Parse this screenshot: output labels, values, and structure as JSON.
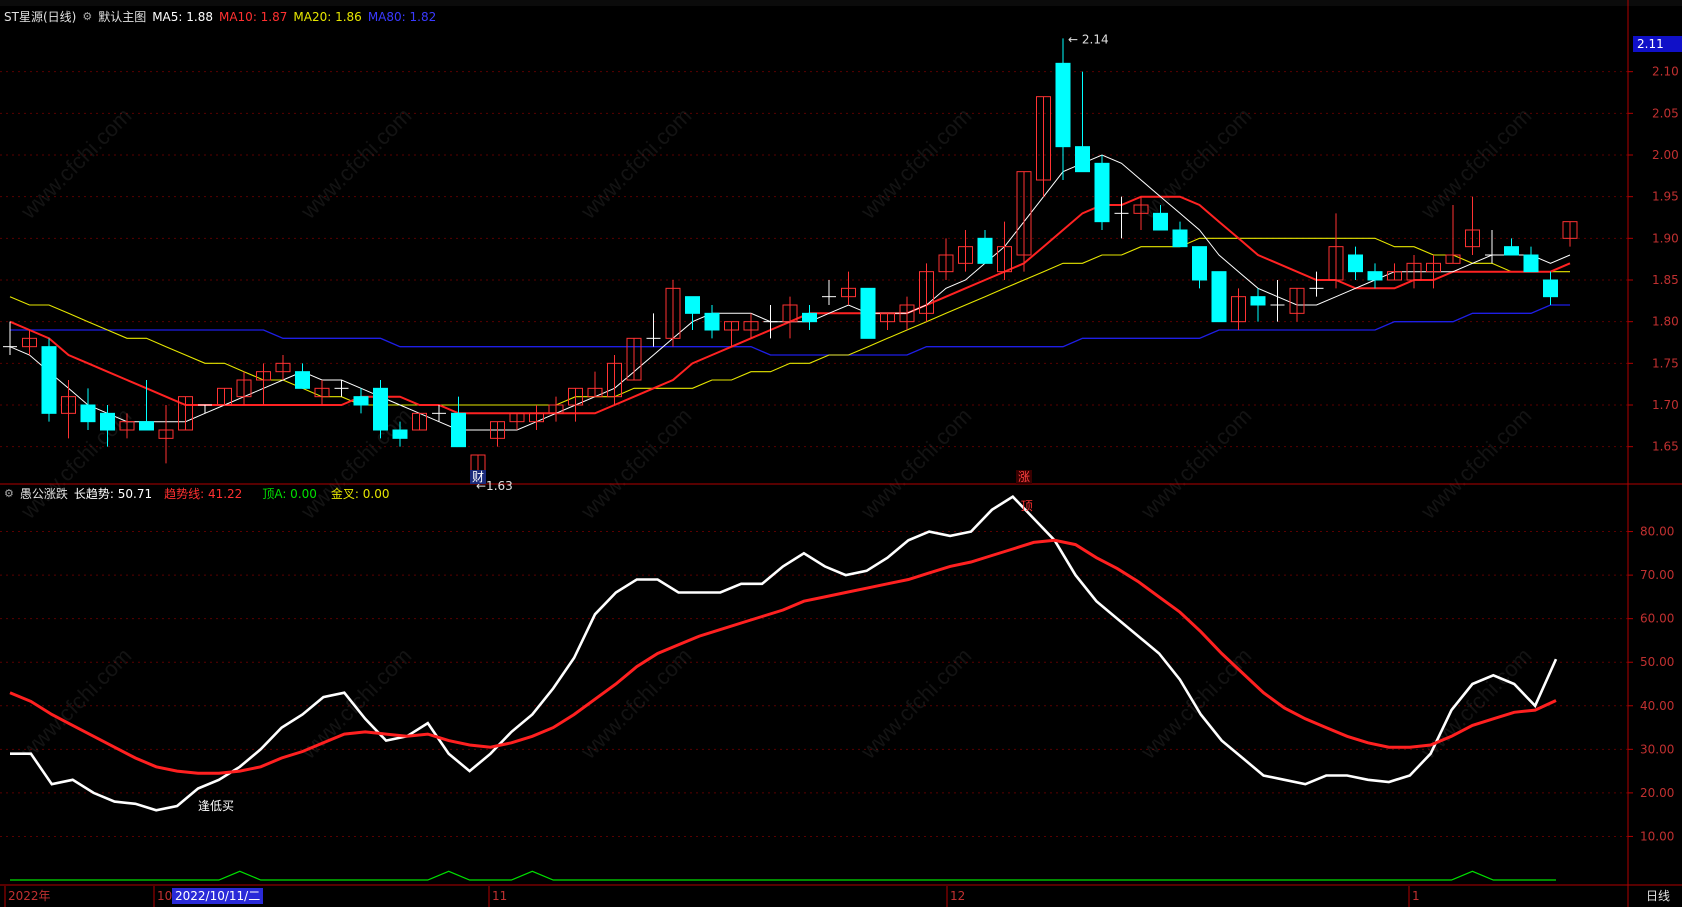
{
  "main_header": {
    "stock_name": "ST星源(日线)",
    "template_name": "默认主图",
    "ma5_label": "MA5: 1.88",
    "ma10_label": "MA10: 1.87",
    "ma20_label": "MA20: 1.86",
    "ma80_label": "MA80: 1.82"
  },
  "sub_header": {
    "indicator_name": "愚公涨跌",
    "long_trend_label": "长趋势: 50.71",
    "trend_line_label": "趋势线: 41.22",
    "top_a_label": "顶A: 0.00",
    "golden_cross_label": "金叉: 0.00"
  },
  "price_axis_labels": [
    "2.10",
    "2.05",
    "2.00",
    "1.95",
    "1.90",
    "1.85",
    "1.80",
    "1.75",
    "1.70",
    "1.65"
  ],
  "current_price_label": "2.11",
  "sub_axis_labels": [
    "80.00",
    "70.00",
    "60.00",
    "50.00",
    "40.00",
    "30.00",
    "20.00",
    "10.00"
  ],
  "date_labels": {
    "year": "2022年",
    "oct": "10",
    "nov": "11",
    "dec": "12",
    "jan": "1"
  },
  "cursor_date": "2022/10/11/二",
  "period_label": "日线",
  "annotations": {
    "high": "2.14",
    "low": "1.63",
    "cai": "财",
    "zhang": "涨",
    "ding": "顶",
    "fengdi": "逢低买"
  },
  "watermark": "www.cfchi.com",
  "colors": {
    "up": "#ff3232",
    "down": "#00ffff",
    "ma5": "#ffffff",
    "ma10": "#ff2222",
    "ma20": "#e6e600",
    "ma80": "#1e1ee6",
    "axis": "#b00000"
  },
  "chart_data": [
    {
      "type": "candlestick",
      "title": "ST星源(日线)",
      "candles": [
        {
          "o": 1.77,
          "h": 1.8,
          "l": 1.76,
          "c": 1.77
        },
        {
          "o": 1.77,
          "h": 1.79,
          "l": 1.76,
          "c": 1.78
        },
        {
          "o": 1.77,
          "h": 1.78,
          "l": 1.68,
          "c": 1.69
        },
        {
          "o": 1.69,
          "h": 1.73,
          "l": 1.66,
          "c": 1.71
        },
        {
          "o": 1.7,
          "h": 1.72,
          "l": 1.67,
          "c": 1.68
        },
        {
          "o": 1.69,
          "h": 1.7,
          "l": 1.65,
          "c": 1.67
        },
        {
          "o": 1.67,
          "h": 1.69,
          "l": 1.66,
          "c": 1.68
        },
        {
          "o": 1.68,
          "h": 1.73,
          "l": 1.67,
          "c": 1.67
        },
        {
          "o": 1.66,
          "h": 1.7,
          "l": 1.63,
          "c": 1.67
        },
        {
          "o": 1.67,
          "h": 1.71,
          "l": 1.67,
          "c": 1.71
        },
        {
          "o": 1.7,
          "h": 1.7,
          "l": 1.69,
          "c": 1.7
        },
        {
          "o": 1.7,
          "h": 1.72,
          "l": 1.7,
          "c": 1.72
        },
        {
          "o": 1.71,
          "h": 1.74,
          "l": 1.7,
          "c": 1.73
        },
        {
          "o": 1.73,
          "h": 1.75,
          "l": 1.7,
          "c": 1.74
        },
        {
          "o": 1.74,
          "h": 1.76,
          "l": 1.73,
          "c": 1.75
        },
        {
          "o": 1.74,
          "h": 1.75,
          "l": 1.72,
          "c": 1.72
        },
        {
          "o": 1.71,
          "h": 1.73,
          "l": 1.7,
          "c": 1.72
        },
        {
          "o": 1.72,
          "h": 1.73,
          "l": 1.71,
          "c": 1.72
        },
        {
          "o": 1.71,
          "h": 1.72,
          "l": 1.69,
          "c": 1.7
        },
        {
          "o": 1.72,
          "h": 1.73,
          "l": 1.66,
          "c": 1.67
        },
        {
          "o": 1.67,
          "h": 1.68,
          "l": 1.65,
          "c": 1.66
        },
        {
          "o": 1.67,
          "h": 1.69,
          "l": 1.67,
          "c": 1.69
        },
        {
          "o": 1.69,
          "h": 1.7,
          "l": 1.68,
          "c": 1.69
        },
        {
          "o": 1.69,
          "h": 1.71,
          "l": 1.67,
          "c": 1.65
        },
        {
          "o": 1.62,
          "h": 1.64,
          "l": 1.61,
          "c": 1.64
        },
        {
          "o": 1.66,
          "h": 1.68,
          "l": 1.65,
          "c": 1.68
        },
        {
          "o": 1.68,
          "h": 1.69,
          "l": 1.67,
          "c": 1.69
        },
        {
          "o": 1.68,
          "h": 1.7,
          "l": 1.67,
          "c": 1.69
        },
        {
          "o": 1.69,
          "h": 1.71,
          "l": 1.68,
          "c": 1.7
        },
        {
          "o": 1.7,
          "h": 1.72,
          "l": 1.68,
          "c": 1.72
        },
        {
          "o": 1.71,
          "h": 1.74,
          "l": 1.71,
          "c": 1.72
        },
        {
          "o": 1.71,
          "h": 1.76,
          "l": 1.7,
          "c": 1.75
        },
        {
          "o": 1.73,
          "h": 1.78,
          "l": 1.73,
          "c": 1.78
        },
        {
          "o": 1.78,
          "h": 1.81,
          "l": 1.77,
          "c": 1.78
        },
        {
          "o": 1.78,
          "h": 1.85,
          "l": 1.77,
          "c": 1.84
        },
        {
          "o": 1.83,
          "h": 1.83,
          "l": 1.79,
          "c": 1.81
        },
        {
          "o": 1.81,
          "h": 1.82,
          "l": 1.78,
          "c": 1.79
        },
        {
          "o": 1.79,
          "h": 1.8,
          "l": 1.77,
          "c": 1.8
        },
        {
          "o": 1.79,
          "h": 1.81,
          "l": 1.78,
          "c": 1.8
        },
        {
          "o": 1.8,
          "h": 1.82,
          "l": 1.78,
          "c": 1.8
        },
        {
          "o": 1.8,
          "h": 1.83,
          "l": 1.78,
          "c": 1.82
        },
        {
          "o": 1.81,
          "h": 1.82,
          "l": 1.79,
          "c": 1.8
        },
        {
          "o": 1.83,
          "h": 1.85,
          "l": 1.82,
          "c": 1.83
        },
        {
          "o": 1.83,
          "h": 1.86,
          "l": 1.82,
          "c": 1.84
        },
        {
          "o": 1.84,
          "h": 1.83,
          "l": 1.78,
          "c": 1.78
        },
        {
          "o": 1.8,
          "h": 1.81,
          "l": 1.79,
          "c": 1.81
        },
        {
          "o": 1.8,
          "h": 1.83,
          "l": 1.79,
          "c": 1.82
        },
        {
          "o": 1.81,
          "h": 1.87,
          "l": 1.8,
          "c": 1.86
        },
        {
          "o": 1.86,
          "h": 1.9,
          "l": 1.85,
          "c": 1.88
        },
        {
          "o": 1.87,
          "h": 1.91,
          "l": 1.86,
          "c": 1.89
        },
        {
          "o": 1.9,
          "h": 1.91,
          "l": 1.87,
          "c": 1.87
        },
        {
          "o": 1.86,
          "h": 1.92,
          "l": 1.85,
          "c": 1.89
        },
        {
          "o": 1.88,
          "h": 1.98,
          "l": 1.86,
          "c": 1.98
        },
        {
          "o": 1.97,
          "h": 2.07,
          "l": 1.95,
          "c": 2.07
        },
        {
          "o": 2.11,
          "h": 2.14,
          "l": 1.97,
          "c": 2.01
        },
        {
          "o": 2.01,
          "h": 2.1,
          "l": 1.98,
          "c": 1.98
        },
        {
          "o": 1.99,
          "h": 2.0,
          "l": 1.91,
          "c": 1.92
        },
        {
          "o": 1.93,
          "h": 1.95,
          "l": 1.9,
          "c": 1.93
        },
        {
          "o": 1.93,
          "h": 1.95,
          "l": 1.91,
          "c": 1.94
        },
        {
          "o": 1.93,
          "h": 1.94,
          "l": 1.91,
          "c": 1.91
        },
        {
          "o": 1.91,
          "h": 1.92,
          "l": 1.89,
          "c": 1.89
        },
        {
          "o": 1.89,
          "h": 1.89,
          "l": 1.84,
          "c": 1.85
        },
        {
          "o": 1.86,
          "h": 1.86,
          "l": 1.8,
          "c": 1.8
        },
        {
          "o": 1.8,
          "h": 1.84,
          "l": 1.79,
          "c": 1.83
        },
        {
          "o": 1.83,
          "h": 1.84,
          "l": 1.8,
          "c": 1.82
        },
        {
          "o": 1.82,
          "h": 1.85,
          "l": 1.8,
          "c": 1.82
        },
        {
          "o": 1.81,
          "h": 1.84,
          "l": 1.8,
          "c": 1.84
        },
        {
          "o": 1.84,
          "h": 1.86,
          "l": 1.83,
          "c": 1.84
        },
        {
          "o": 1.85,
          "h": 1.93,
          "l": 1.84,
          "c": 1.89
        },
        {
          "o": 1.88,
          "h": 1.89,
          "l": 1.85,
          "c": 1.86
        },
        {
          "o": 1.86,
          "h": 1.87,
          "l": 1.84,
          "c": 1.85
        },
        {
          "o": 1.85,
          "h": 1.87,
          "l": 1.85,
          "c": 1.86
        },
        {
          "o": 1.85,
          "h": 1.88,
          "l": 1.84,
          "c": 1.87
        },
        {
          "o": 1.86,
          "h": 1.88,
          "l": 1.84,
          "c": 1.87
        },
        {
          "o": 1.87,
          "h": 1.94,
          "l": 1.87,
          "c": 1.88
        },
        {
          "o": 1.89,
          "h": 1.95,
          "l": 1.88,
          "c": 1.91
        },
        {
          "o": 1.88,
          "h": 1.91,
          "l": 1.87,
          "c": 1.88
        },
        {
          "o": 1.89,
          "h": 1.9,
          "l": 1.88,
          "c": 1.88
        },
        {
          "o": 1.88,
          "h": 1.89,
          "l": 1.86,
          "c": 1.86
        },
        {
          "o": 1.85,
          "h": 1.86,
          "l": 1.82,
          "c": 1.83
        },
        {
          "o": 1.9,
          "h": 1.92,
          "l": 1.89,
          "c": 1.92
        }
      ],
      "ma": {
        "ma5": [
          1.77,
          1.76,
          1.74,
          1.72,
          1.7,
          1.69,
          1.68,
          1.68,
          1.68,
          1.68,
          1.69,
          1.7,
          1.71,
          1.72,
          1.73,
          1.74,
          1.73,
          1.73,
          1.72,
          1.71,
          1.7,
          1.69,
          1.68,
          1.67,
          1.67,
          1.67,
          1.67,
          1.68,
          1.69,
          1.7,
          1.71,
          1.72,
          1.74,
          1.76,
          1.78,
          1.8,
          1.81,
          1.81,
          1.81,
          1.8,
          1.8,
          1.8,
          1.81,
          1.82,
          1.81,
          1.81,
          1.81,
          1.82,
          1.84,
          1.85,
          1.87,
          1.89,
          1.92,
          1.95,
          1.98,
          1.99,
          2.0,
          1.99,
          1.97,
          1.95,
          1.93,
          1.91,
          1.88,
          1.86,
          1.84,
          1.83,
          1.82,
          1.82,
          1.83,
          1.84,
          1.85,
          1.86,
          1.86,
          1.86,
          1.86,
          1.87,
          1.88,
          1.88,
          1.88,
          1.87,
          1.88
        ],
        "ma10": [
          1.8,
          1.79,
          1.78,
          1.76,
          1.75,
          1.74,
          1.73,
          1.72,
          1.71,
          1.7,
          1.7,
          1.7,
          1.7,
          1.7,
          1.7,
          1.7,
          1.7,
          1.7,
          1.71,
          1.71,
          1.71,
          1.7,
          1.7,
          1.69,
          1.69,
          1.69,
          1.69,
          1.69,
          1.69,
          1.69,
          1.69,
          1.7,
          1.71,
          1.72,
          1.73,
          1.75,
          1.76,
          1.77,
          1.78,
          1.79,
          1.8,
          1.81,
          1.81,
          1.81,
          1.81,
          1.81,
          1.81,
          1.82,
          1.83,
          1.84,
          1.85,
          1.86,
          1.87,
          1.89,
          1.91,
          1.93,
          1.94,
          1.94,
          1.95,
          1.95,
          1.95,
          1.94,
          1.92,
          1.9,
          1.88,
          1.87,
          1.86,
          1.85,
          1.85,
          1.84,
          1.84,
          1.84,
          1.85,
          1.85,
          1.86,
          1.86,
          1.86,
          1.86,
          1.86,
          1.86,
          1.87
        ],
        "ma20": [
          1.83,
          1.82,
          1.82,
          1.81,
          1.8,
          1.79,
          1.78,
          1.78,
          1.77,
          1.76,
          1.75,
          1.75,
          1.74,
          1.73,
          1.73,
          1.72,
          1.71,
          1.71,
          1.7,
          1.7,
          1.7,
          1.7,
          1.7,
          1.7,
          1.7,
          1.7,
          1.7,
          1.7,
          1.7,
          1.71,
          1.71,
          1.71,
          1.72,
          1.72,
          1.72,
          1.72,
          1.73,
          1.73,
          1.74,
          1.74,
          1.75,
          1.75,
          1.76,
          1.76,
          1.77,
          1.78,
          1.79,
          1.8,
          1.81,
          1.82,
          1.83,
          1.84,
          1.85,
          1.86,
          1.87,
          1.87,
          1.88,
          1.88,
          1.89,
          1.89,
          1.89,
          1.9,
          1.9,
          1.9,
          1.9,
          1.9,
          1.9,
          1.9,
          1.9,
          1.9,
          1.9,
          1.89,
          1.89,
          1.88,
          1.88,
          1.87,
          1.87,
          1.86,
          1.86,
          1.86,
          1.86
        ],
        "ma80": [
          1.79,
          1.79,
          1.79,
          1.79,
          1.79,
          1.79,
          1.79,
          1.79,
          1.79,
          1.79,
          1.79,
          1.79,
          1.79,
          1.79,
          1.78,
          1.78,
          1.78,
          1.78,
          1.78,
          1.78,
          1.77,
          1.77,
          1.77,
          1.77,
          1.77,
          1.77,
          1.77,
          1.77,
          1.77,
          1.77,
          1.77,
          1.77,
          1.77,
          1.77,
          1.77,
          1.77,
          1.77,
          1.77,
          1.77,
          1.76,
          1.76,
          1.76,
          1.76,
          1.76,
          1.76,
          1.76,
          1.76,
          1.77,
          1.77,
          1.77,
          1.77,
          1.77,
          1.77,
          1.77,
          1.77,
          1.78,
          1.78,
          1.78,
          1.78,
          1.78,
          1.78,
          1.78,
          1.79,
          1.79,
          1.79,
          1.79,
          1.79,
          1.79,
          1.79,
          1.79,
          1.79,
          1.8,
          1.8,
          1.8,
          1.8,
          1.81,
          1.81,
          1.81,
          1.81,
          1.82,
          1.82
        ]
      },
      "ylim": [
        1.61,
        2.15
      ]
    },
    {
      "type": "line",
      "title": "愚公涨跌",
      "ylim": [
        0,
        90
      ],
      "series": [
        {
          "name": "长趋势",
          "values": [
            29,
            29,
            22,
            23,
            20,
            18,
            17.5,
            16,
            17,
            21,
            23,
            26,
            30,
            35,
            38,
            42,
            43,
            37,
            32,
            33,
            36,
            29,
            25,
            29,
            34,
            38,
            44,
            51,
            61,
            66,
            69,
            69,
            66,
            66,
            66,
            68,
            68,
            72,
            75,
            72,
            70,
            71,
            74,
            78,
            80,
            79,
            80,
            85,
            88,
            83,
            78,
            70,
            64,
            60,
            56,
            52,
            46,
            38,
            32,
            28,
            24,
            23,
            22,
            24,
            24,
            23,
            22.5,
            24,
            29,
            39,
            45,
            47,
            45,
            40,
            50.71
          ]
        },
        {
          "name": "趋势线",
          "values": [
            43,
            41,
            38,
            35.5,
            33,
            30.5,
            28,
            26,
            25,
            24.5,
            24.5,
            25,
            26,
            28,
            29.5,
            31.5,
            33.5,
            34,
            33.5,
            33,
            33.5,
            32,
            31,
            30.5,
            31.5,
            33,
            35,
            38,
            41.5,
            45,
            49,
            52,
            54,
            56,
            57.5,
            59,
            60.5,
            62,
            64,
            65,
            66,
            67,
            68,
            69,
            70.5,
            72,
            73,
            74.5,
            76,
            77.5,
            78,
            77,
            74,
            71.5,
            68.5,
            65,
            61.5,
            57,
            52,
            47.5,
            43,
            39.5,
            37,
            35,
            33,
            31.5,
            30.5,
            30.5,
            31,
            33,
            35.5,
            37,
            38.5,
            39,
            41.22
          ]
        },
        {
          "name": "顶A",
          "values": [
            0,
            0,
            0,
            0,
            0,
            0,
            0,
            0,
            0,
            0,
            0,
            2,
            0,
            0,
            0,
            0,
            0,
            0,
            0,
            0,
            0,
            2,
            0,
            0,
            0,
            2,
            0,
            0,
            0,
            0,
            0,
            0,
            0,
            0,
            0,
            0,
            0,
            0,
            0,
            0,
            0,
            0,
            0,
            0,
            0,
            0,
            0,
            0,
            0,
            0,
            0,
            0,
            0,
            0,
            0,
            0,
            0,
            0,
            0,
            0,
            0,
            0,
            0,
            0,
            0,
            0,
            0,
            0,
            0,
            0,
            2,
            0,
            0,
            0,
            0
          ]
        }
      ]
    }
  ]
}
